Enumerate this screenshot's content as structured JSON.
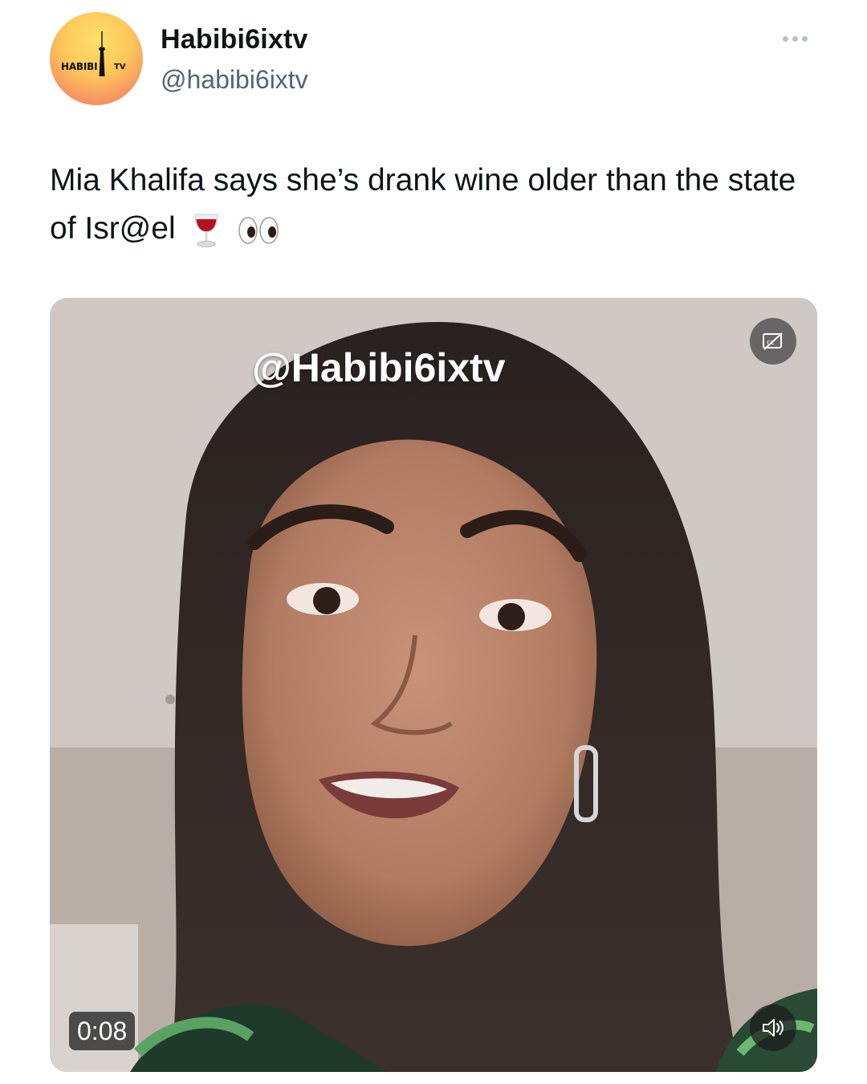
{
  "account": {
    "display_name": "Habibi6ixtv",
    "handle": "@habibi6ixtv",
    "avatar_text": "HABIBI",
    "avatar_text_2": "TV"
  },
  "tweet": {
    "text": "Mia Khalifa says she’s drank wine older than the state of Isr@el",
    "emojis": [
      "wine-glass-icon",
      "eyes-icon"
    ]
  },
  "video": {
    "watermark": "@Habibi6ixtv",
    "duration": "0:08",
    "captions_icon": "captions-off-icon",
    "volume_icon": "volume-muted-icon"
  },
  "colors": {
    "text": "#0f1419",
    "secondary": "#536471",
    "avatar_gradient": [
      "#fde16a",
      "#f27a67"
    ]
  }
}
